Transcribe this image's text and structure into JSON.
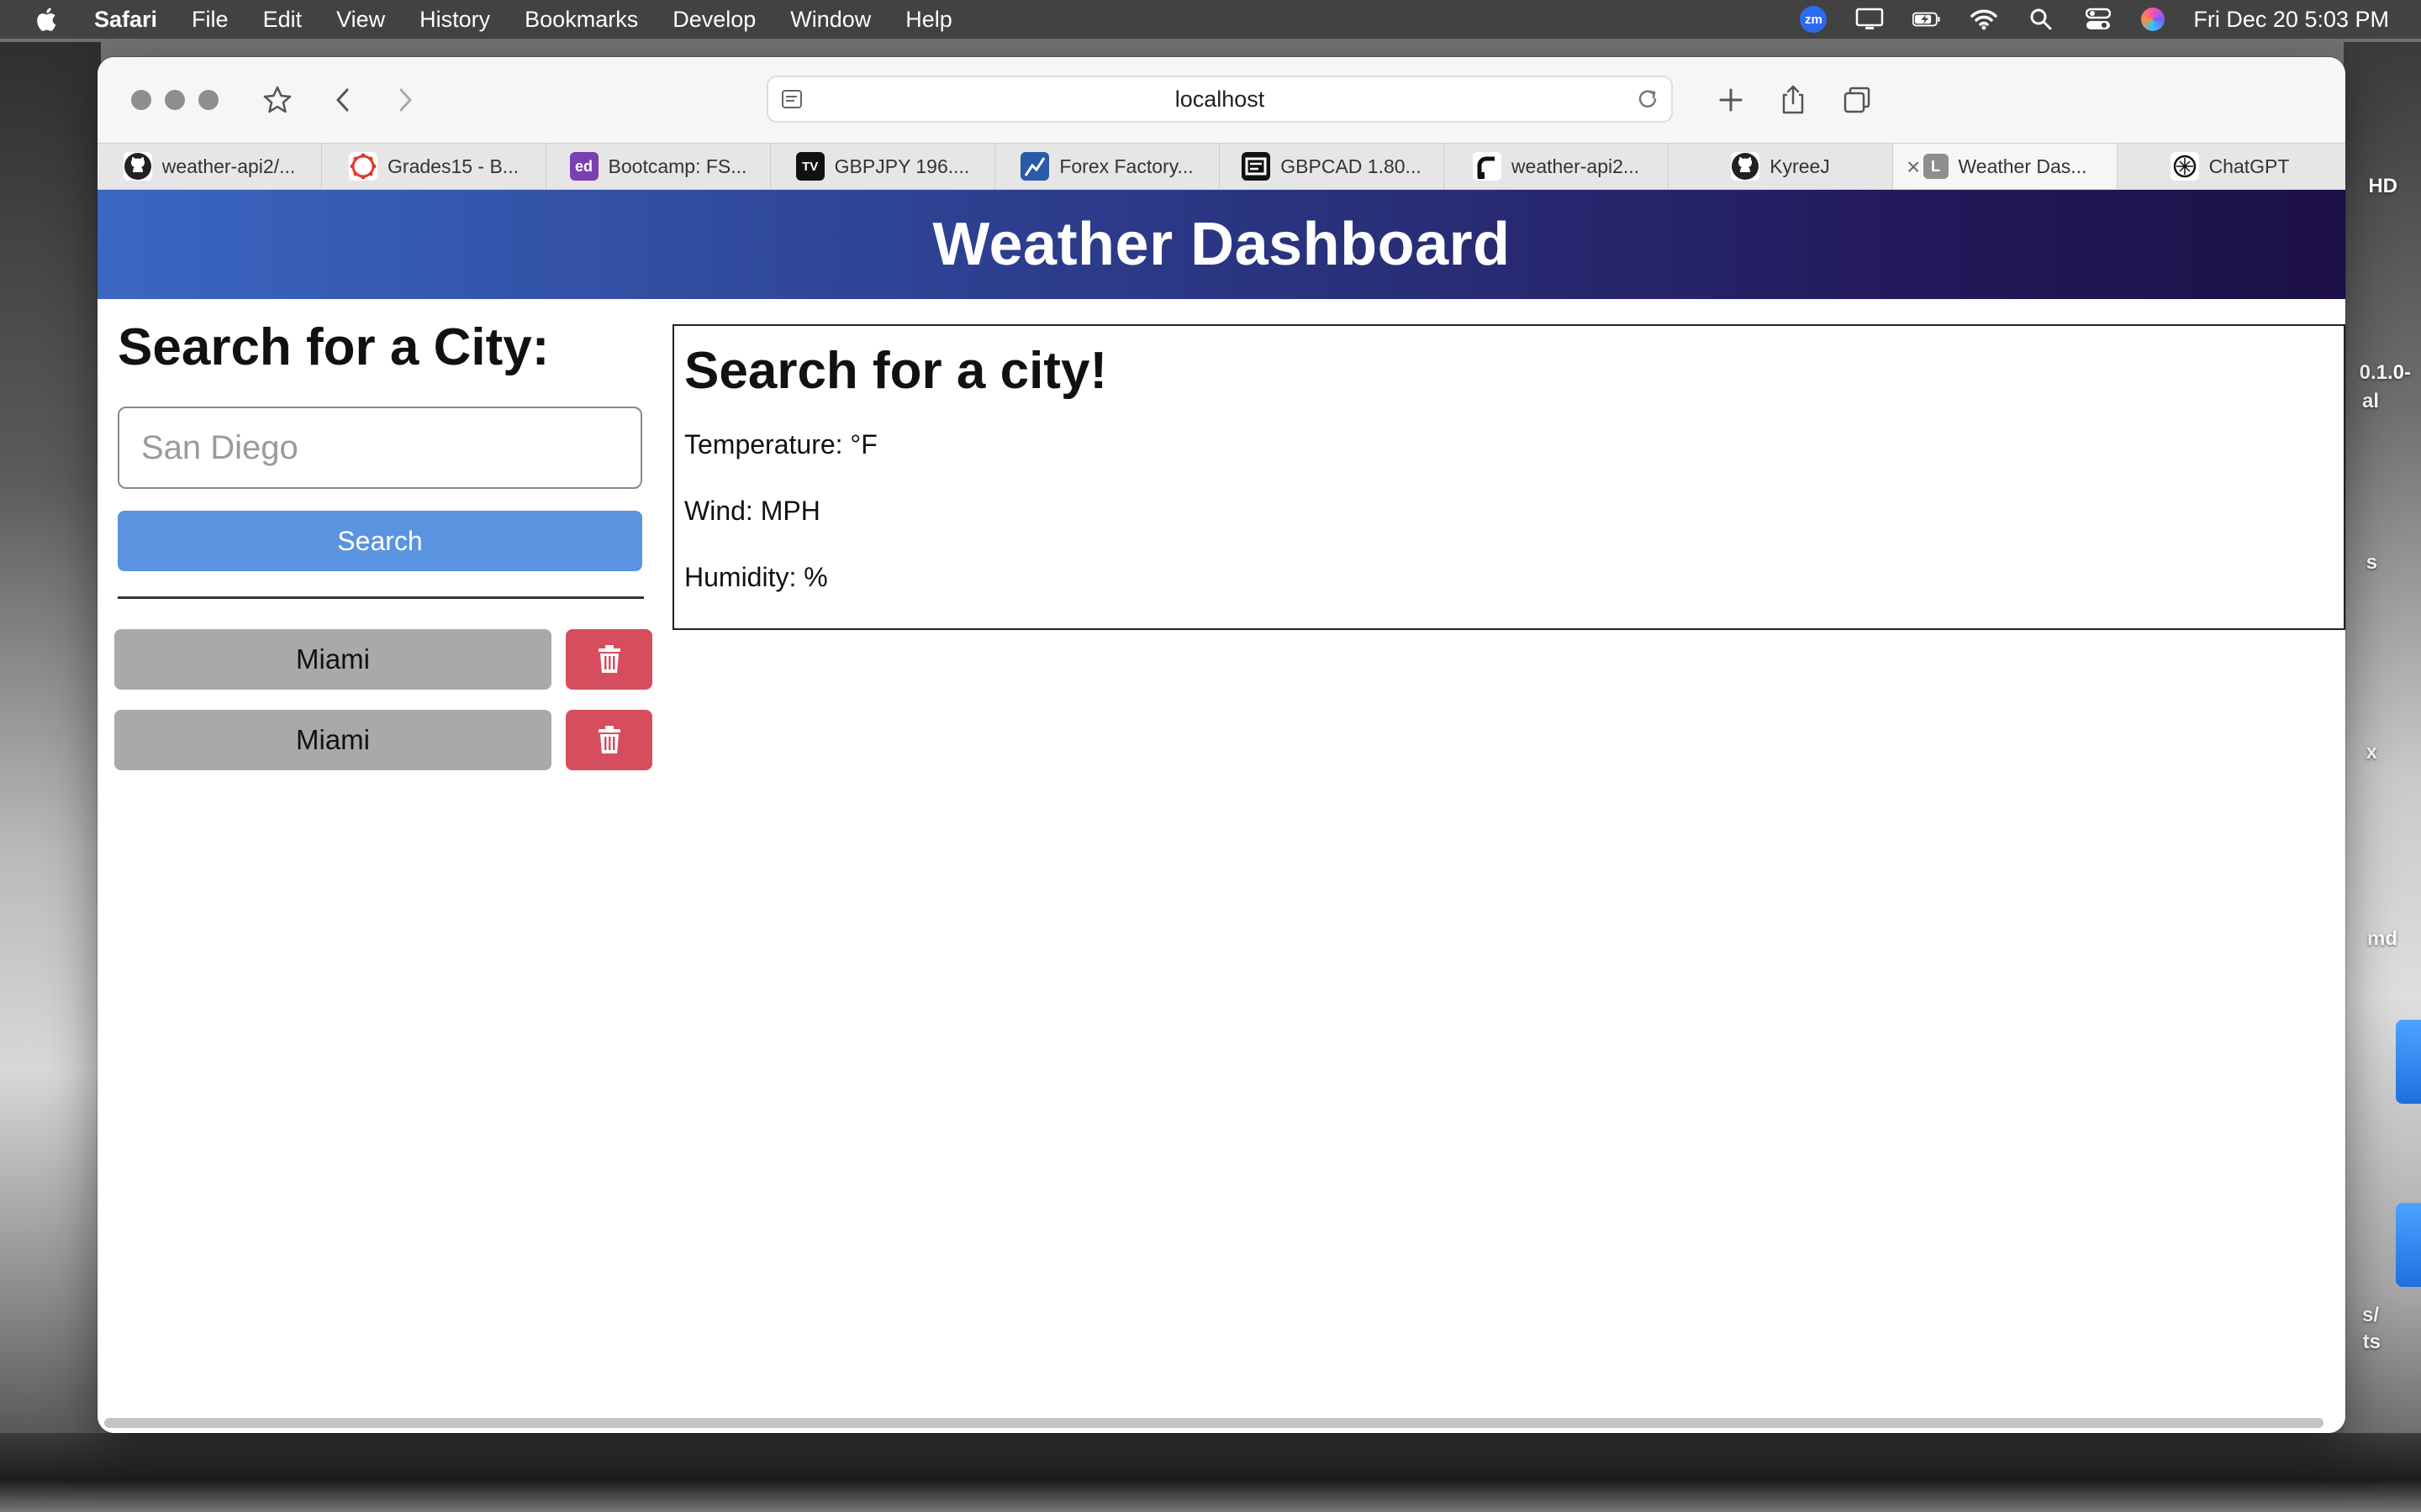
{
  "menubar": {
    "app_name": "Safari",
    "items": [
      "File",
      "Edit",
      "View",
      "History",
      "Bookmarks",
      "Develop",
      "Window",
      "Help"
    ],
    "zoom_label": "zm",
    "datetime": "Fri Dec 20  5:03 PM"
  },
  "desktop": {
    "labels": [
      "HD",
      "0.1.0-",
      "al",
      "s",
      "x",
      "md",
      "s/",
      "ts"
    ]
  },
  "browser": {
    "url": "localhost",
    "tabs": [
      {
        "label": "weather-api2/...",
        "icon": "github-icon"
      },
      {
        "label": "Grades15 - B...",
        "icon": "canvas-icon"
      },
      {
        "label": "Bootcamp: FS...",
        "icon": "edstem-icon",
        "icon_text": "ed"
      },
      {
        "label": "GBPJPY 196....",
        "icon": "tradingview-icon",
        "icon_text": "TV"
      },
      {
        "label": "Forex Factory...",
        "icon": "forexfactory-icon"
      },
      {
        "label": "GBPCAD 1.80...",
        "icon": "chart-icon"
      },
      {
        "label": "weather-api2...",
        "icon": "render-icon"
      },
      {
        "label": "KyreeJ",
        "icon": "github-icon"
      },
      {
        "label": "Weather Das...",
        "icon": "page-letter-icon",
        "icon_text": "L",
        "active": true
      },
      {
        "label": "ChatGPT",
        "icon": "chatgpt-icon"
      }
    ]
  },
  "app": {
    "title": "Weather Dashboard",
    "search": {
      "heading": "Search for a City:",
      "placeholder": "San Diego",
      "button_label": "Search"
    },
    "history": [
      {
        "city": "Miami"
      },
      {
        "city": "Miami"
      }
    ],
    "current": {
      "heading": "Search for a city!",
      "temperature": "Temperature: °F",
      "wind": "Wind: MPH",
      "humidity": "Humidity: %"
    }
  },
  "colors": {
    "header_gradient_start": "#3a67c2",
    "header_gradient_end": "#1c1046",
    "search_button": "#5a94e0",
    "history_button": "#a9a9a9",
    "delete_button": "#d64e5d"
  }
}
